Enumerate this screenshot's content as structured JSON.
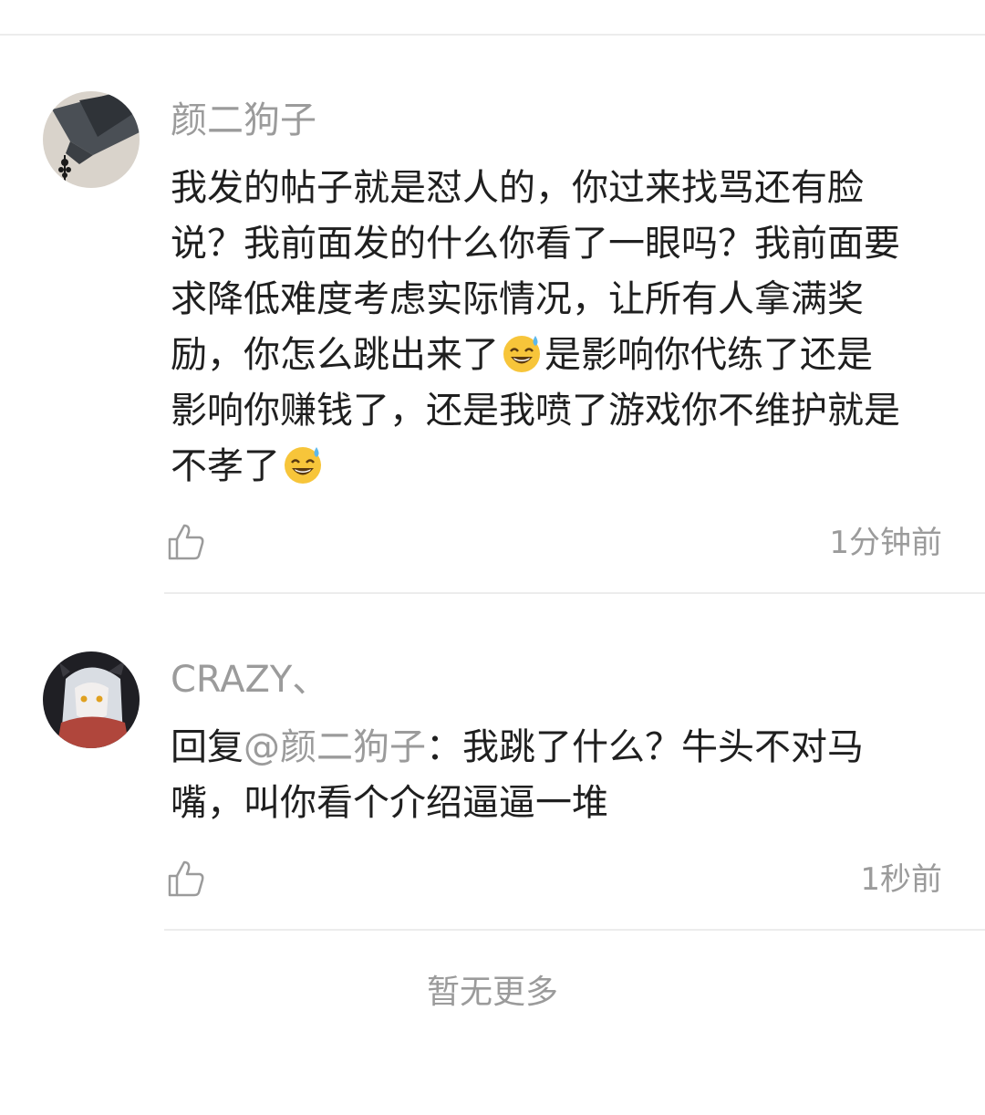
{
  "comments": [
    {
      "username": "颜二狗子",
      "lines": [
        {
          "text": "我发的帖子就是怼人的，你过来找骂还有脸"
        },
        {
          "text": "说？我前面发的什么你看了一眼吗？我前面要"
        },
        {
          "text": "求降低难度考虑实际情况，让所有人拿满奖"
        },
        {
          "before": "励，你怎么跳出来了",
          "emoji": "sweat-smile",
          "after": "是影响你代练了还是"
        },
        {
          "text": "影响你赚钱了，还是我喷了游戏你不维护就是"
        },
        {
          "before": "不孝了",
          "emoji": "sweat-smile",
          "after": ""
        }
      ],
      "timestamp": "1分钟前",
      "avatar_icon": "dark-fan-avatar-icon",
      "like_icon": "thumbs-up-icon"
    },
    {
      "username": "CRAZY、",
      "reply_prefix": "回复",
      "mention": "@颜二狗子",
      "line1_rest": "：我跳了什么？牛头不对马",
      "line2": "嘴，叫你看个介绍逼逼一堆",
      "timestamp": "1秒前",
      "avatar_icon": "anime-character-avatar-icon",
      "like_icon": "thumbs-up-icon"
    }
  ],
  "footer": {
    "text": "暂无更多"
  },
  "colors": {
    "text_primary": "#1f1f1f",
    "text_secondary": "#9b9b9b",
    "divider": "#ececec"
  }
}
